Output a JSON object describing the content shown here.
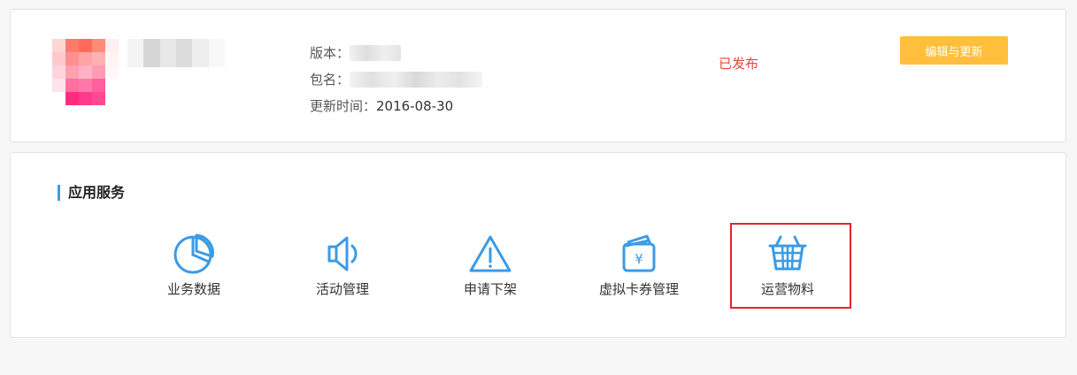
{
  "app": {
    "version_label": "版本：",
    "package_label": "包名：",
    "updated_label": "更新时间：",
    "updated_value": "2016-08-30",
    "status": "已发布",
    "edit_button": "编辑与更新"
  },
  "services": {
    "title": "应用服务",
    "items": [
      {
        "label": "业务数据",
        "icon": "pie-chart-icon"
      },
      {
        "label": "活动管理",
        "icon": "speaker-icon"
      },
      {
        "label": "申请下架",
        "icon": "warning-triangle-icon"
      },
      {
        "label": "虚拟卡券管理",
        "icon": "wallet-yen-icon"
      },
      {
        "label": "运营物料",
        "icon": "shopping-basket-icon"
      }
    ],
    "highlighted_index": 4
  },
  "colors": {
    "accent": "#3b9be6",
    "status": "#e8443a",
    "button": "#ffbf3d",
    "highlight": "#e0262b"
  }
}
